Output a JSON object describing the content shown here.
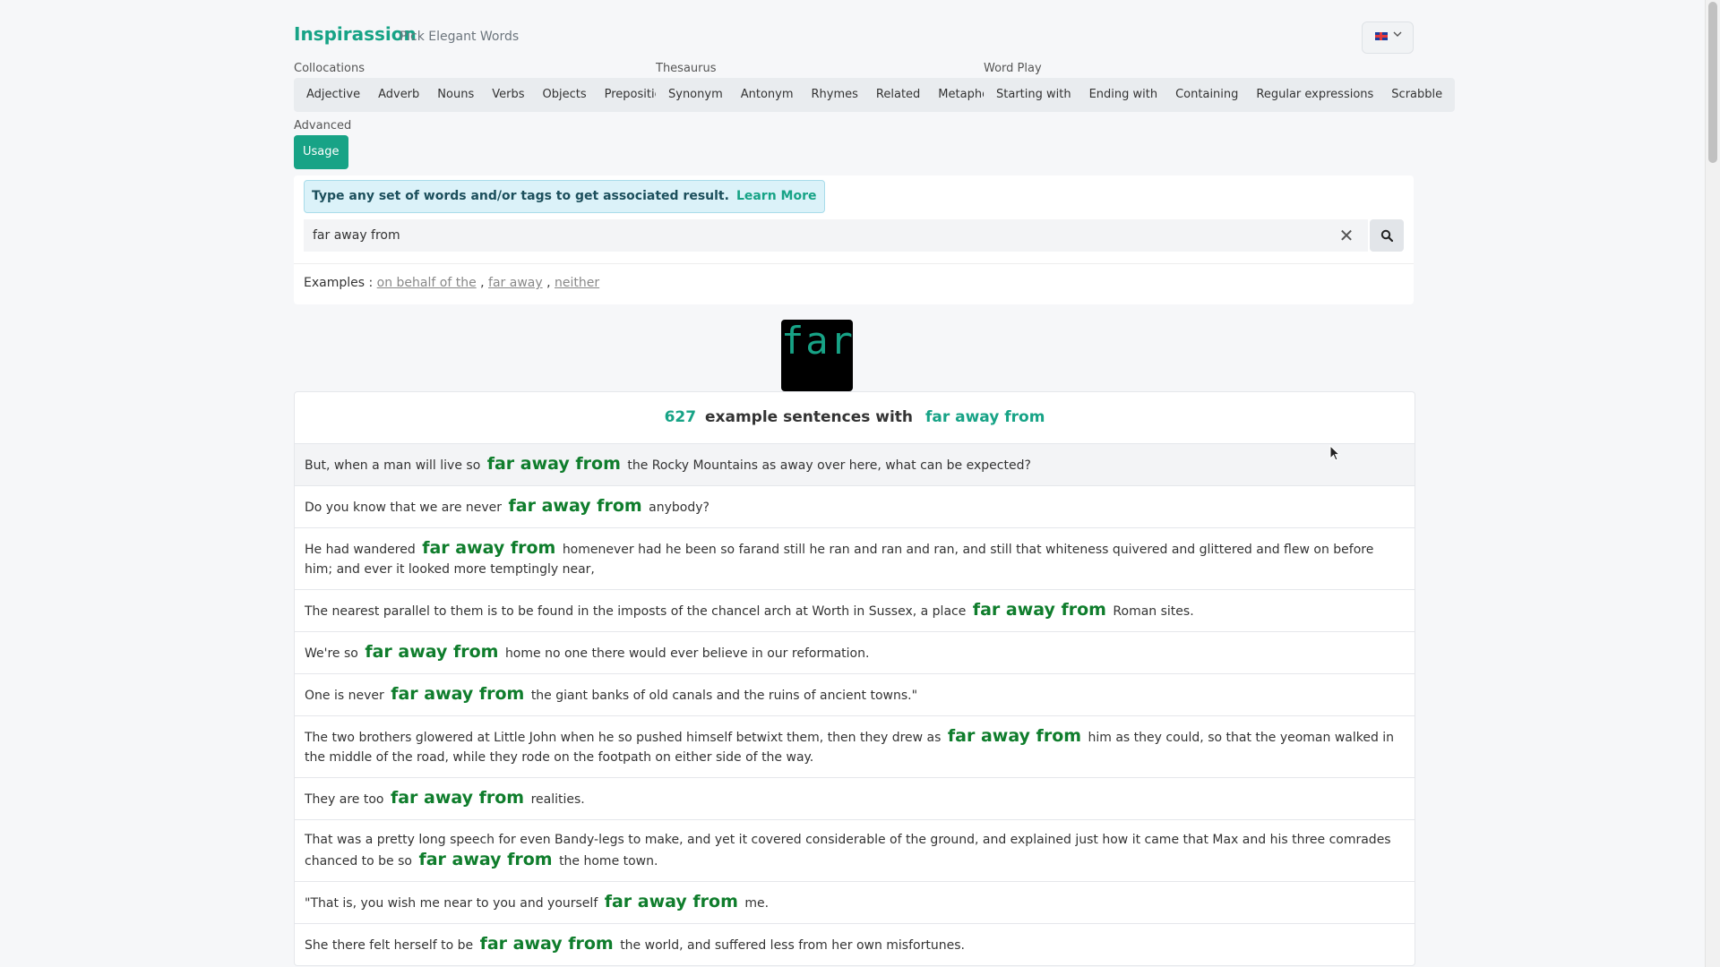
{
  "header": {
    "brand": "Inspirassion",
    "tagline": "Pick Elegant Words"
  },
  "nav": {
    "collocations": {
      "label": "Collocations",
      "items": [
        "Adjective",
        "Adverb",
        "Nouns",
        "Verbs",
        "Objects",
        "Prepositions"
      ]
    },
    "thesaurus": {
      "label": "Thesaurus",
      "items": [
        "Synonym",
        "Antonym",
        "Rhymes",
        "Related",
        "Metaphors"
      ]
    },
    "wordplay": {
      "label": "Word Play",
      "items": [
        "Starting with",
        "Ending with",
        "Containing",
        "Regular expressions",
        "Scrabble"
      ]
    },
    "advanced": {
      "label": "Advanced",
      "usage": "Usage"
    }
  },
  "search": {
    "info": "Type any set of words and/or tags to get associated result.",
    "learn_more": "Learn More",
    "value": "far away from",
    "clear_glyph": "✕",
    "examples_label": "Examples :",
    "examples": [
      "on behalf of the",
      "far away",
      "neither"
    ]
  },
  "logo_text": "far",
  "results": {
    "count": "627",
    "label": "example sentences with",
    "phrase": "far away from",
    "sentences": [
      {
        "pre": "But, when a man will live so",
        "hit": "far away from",
        "post": "the Rocky Mountains as away over here, what can be expected?"
      },
      {
        "pre": "Do you know that we are never",
        "hit": "far away from",
        "post": "anybody?"
      },
      {
        "pre": "He had wandered",
        "hit": "far away from",
        "post": "homenever had he been so farand still he ran and ran and ran, and still that whiteness quivered and glittered and flew on before him; and ever it looked more temptingly near,"
      },
      {
        "pre": "The nearest parallel to them is to be found in the imposts of the chancel arch at Worth in Sussex, a place",
        "hit": "far away from",
        "post": "Roman sites."
      },
      {
        "pre": "We're so",
        "hit": "far away from",
        "post": "home no one there would ever believe in our reformation."
      },
      {
        "pre": "One is never",
        "hit": "far away from",
        "post": "the giant banks of old canals and the ruins of ancient towns.\""
      },
      {
        "pre": "The two brothers glowered at Little John when he so pushed himself betwixt them, then they drew as",
        "hit": "far away from",
        "post": "him as they could, so that the yeoman walked in the middle of the road, while they rode on the footpath on either side of the way."
      },
      {
        "pre": "They are too",
        "hit": "far away from",
        "post": "realities."
      },
      {
        "pre": "That was a pretty long speech for even Bandy-legs to make, and yet it covered considerable of the ground, and explained just how it came that Max and his three comrades chanced to be so",
        "hit": "far away from",
        "post": "the home town."
      },
      {
        "pre": "\"That is, you wish me near to you and yourself",
        "hit": "far away from",
        "post": "me."
      },
      {
        "pre": "She there felt herself to be",
        "hit": "far away from",
        "post": "the world, and suffered less from her own misfortunes."
      }
    ]
  },
  "colors": {
    "accent": "#17a386",
    "hit": "#0f7d2c",
    "info_bg": "#dbf2f9"
  }
}
